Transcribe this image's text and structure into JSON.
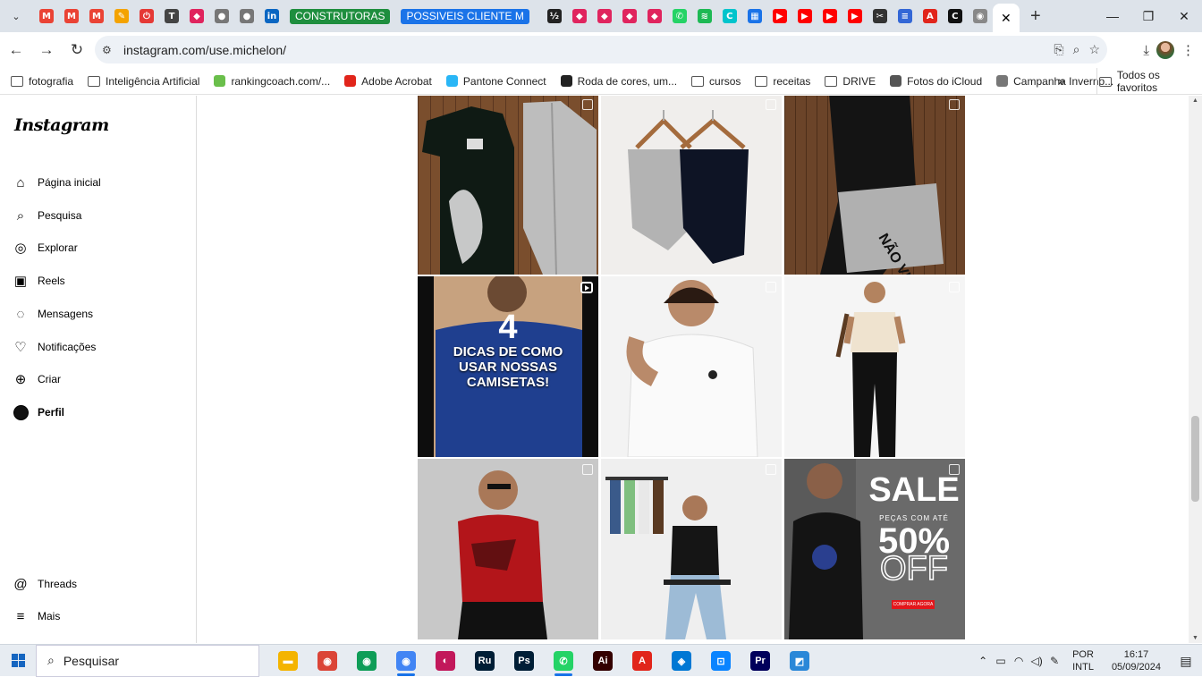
{
  "browser": {
    "url": "instagram.com/use.michelon/",
    "pinned_tabs": [
      {
        "icon": "gmail-icon",
        "color": "#ea4335",
        "glyph": "M"
      },
      {
        "icon": "gmail-icon",
        "color": "#ea4335",
        "glyph": "M"
      },
      {
        "icon": "gmail-icon",
        "color": "#ea4335",
        "glyph": "M"
      },
      {
        "icon": "pencil-app-icon",
        "color": "#f4a300",
        "glyph": "✎"
      },
      {
        "icon": "power-app-icon",
        "color": "#e53935",
        "glyph": "⏻"
      },
      {
        "icon": "t-app-icon",
        "color": "#444444",
        "glyph": "T"
      },
      {
        "icon": "diamond-app-icon",
        "color": "#e0245e",
        "glyph": "◆"
      },
      {
        "icon": "globe-icon",
        "color": "#777777",
        "glyph": "●"
      },
      {
        "icon": "globe-icon",
        "color": "#777777",
        "glyph": "●"
      },
      {
        "icon": "linkedin-icon",
        "color": "#0a66c2",
        "glyph": "in"
      }
    ],
    "label_tabs": [
      {
        "label": "CONSTRUTORAS",
        "color": "#1e8e3e"
      },
      {
        "label": "POSSIVEIS CLIENTE M",
        "color": "#1a73e8"
      }
    ],
    "pinned_tabs_2": [
      {
        "icon": "dark-app-icon",
        "color": "#222222",
        "glyph": "½"
      },
      {
        "icon": "diamond-app-icon",
        "color": "#e0245e",
        "glyph": "◆"
      },
      {
        "icon": "diamond-app-icon",
        "color": "#e0245e",
        "glyph": "◆"
      },
      {
        "icon": "diamond-app-icon",
        "color": "#e0245e",
        "glyph": "◆"
      },
      {
        "icon": "diamond-app-icon",
        "color": "#e0245e",
        "glyph": "◆"
      },
      {
        "icon": "whatsapp-icon",
        "color": "#25d366",
        "glyph": "✆"
      },
      {
        "icon": "spotify-icon",
        "color": "#1db954",
        "glyph": "≋"
      },
      {
        "icon": "canva-icon",
        "color": "#00c4cc",
        "glyph": "C"
      },
      {
        "icon": "calendar-icon",
        "color": "#1a73e8",
        "glyph": "▦"
      },
      {
        "icon": "youtube-icon",
        "color": "#ff0000",
        "glyph": "▶"
      },
      {
        "icon": "youtube-icon",
        "color": "#ff0000",
        "glyph": "▶"
      },
      {
        "icon": "youtube-icon",
        "color": "#ff0000",
        "glyph": "▶"
      },
      {
        "icon": "youtube-icon",
        "color": "#ff0000",
        "glyph": "▶"
      },
      {
        "icon": "capcut-icon",
        "color": "#333333",
        "glyph": "✂"
      },
      {
        "icon": "forms-icon",
        "color": "#3367d6",
        "glyph": "≡"
      },
      {
        "icon": "acrobat-icon",
        "color": "#e1251b",
        "glyph": "A"
      },
      {
        "icon": "circle-app-icon",
        "color": "#111111",
        "glyph": "C"
      },
      {
        "icon": "chrome-icon",
        "color": "#888888",
        "glyph": "◉"
      }
    ],
    "active_tab_close": "✕",
    "new_tab": "+",
    "bookmarks": [
      {
        "label": "fotografia",
        "icon": "folder-icon"
      },
      {
        "label": "Inteligência Artificial",
        "icon": "folder-icon"
      },
      {
        "label": "rankingcoach.com/...",
        "icon": "rankingcoach-icon"
      },
      {
        "label": "Adobe Acrobat",
        "icon": "acrobat-icon"
      },
      {
        "label": "Pantone Connect",
        "icon": "pantone-icon"
      },
      {
        "label": "Roda de cores, um...",
        "icon": "color-wheel-icon"
      },
      {
        "label": "cursos",
        "icon": "folder-icon"
      },
      {
        "label": "receitas",
        "icon": "folder-icon"
      },
      {
        "label": "DRIVE",
        "icon": "folder-icon"
      },
      {
        "label": "Fotos do iCloud",
        "icon": "apple-icon"
      },
      {
        "label": "Campanha Inverno...",
        "icon": "globe-icon"
      }
    ],
    "bookmarks_more": "»",
    "all_bookmarks": "Todos os favoritos"
  },
  "instagram": {
    "logo": "Instagram",
    "nav": [
      {
        "label": "Página inicial",
        "icon": "home-icon",
        "glyph": "⌂"
      },
      {
        "label": "Pesquisa",
        "icon": "search-icon",
        "glyph": "⌕"
      },
      {
        "label": "Explorar",
        "icon": "compass-icon",
        "glyph": "◎"
      },
      {
        "label": "Reels",
        "icon": "reels-icon",
        "glyph": "▣"
      },
      {
        "label": "Mensagens",
        "icon": "messenger-icon",
        "glyph": "◌"
      },
      {
        "label": "Notificações",
        "icon": "heart-icon",
        "glyph": "♡"
      },
      {
        "label": "Criar",
        "icon": "plus-square-icon",
        "glyph": "⊕"
      },
      {
        "label": "Perfil",
        "icon": "profile-avatar",
        "glyph": ""
      }
    ],
    "bottom_nav": [
      {
        "label": "Threads",
        "icon": "threads-icon",
        "glyph": "@"
      },
      {
        "label": "Mais",
        "icon": "menu-icon",
        "glyph": "≡"
      }
    ],
    "posts": [
      {
        "kind": "carousel",
        "alt": "post-tshirt-lion-pants"
      },
      {
        "kind": "carousel",
        "alt": "post-pants-hangers"
      },
      {
        "kind": "carousel",
        "alt": "post-black-pants-gray-tee"
      },
      {
        "kind": "reel",
        "alt": "post-dicas-camisetas",
        "text_num": "4",
        "text": [
          "DICAS DE COMO",
          "USAR NOSSAS",
          "CAMISETAS!"
        ]
      },
      {
        "kind": "carousel",
        "alt": "post-white-tee-man"
      },
      {
        "kind": "carousel",
        "alt": "post-cream-tee-man"
      },
      {
        "kind": "carousel",
        "alt": "post-red-tee-man"
      },
      {
        "kind": "carousel",
        "alt": "post-black-tee-chair"
      },
      {
        "kind": "carousel",
        "alt": "post-sale",
        "sale": "SALE",
        "sale_sub": "PEÇAS COM ATÉ",
        "sale_pct": "50%",
        "sale_off": "OFF",
        "sale_btn": "COMPRAR AGORA"
      }
    ]
  },
  "taskbar": {
    "search_placeholder": "Pesquisar",
    "apps": [
      {
        "icon": "file-explorer-icon",
        "color": "#f4b400",
        "glyph": "▬"
      },
      {
        "icon": "chrome-icon",
        "color": "#db4437",
        "glyph": "◉"
      },
      {
        "icon": "chrome-icon",
        "color": "#0f9d58",
        "glyph": "◉"
      },
      {
        "icon": "chrome-icon",
        "color": "#4285f4",
        "glyph": "◉",
        "active": true
      },
      {
        "icon": "photo-app-icon",
        "color": "#c2185b",
        "glyph": "◐"
      },
      {
        "icon": "lightroom-icon",
        "color": "#001e36",
        "glyph": "Ru"
      },
      {
        "icon": "photoshop-icon",
        "color": "#001e36",
        "glyph": "Ps"
      },
      {
        "icon": "whatsapp-icon",
        "color": "#25d366",
        "glyph": "✆",
        "active": true
      },
      {
        "icon": "illustrator-icon",
        "color": "#330000",
        "glyph": "Ai"
      },
      {
        "icon": "acrobat-icon",
        "color": "#e1251b",
        "glyph": "A"
      },
      {
        "icon": "store-icon",
        "color": "#0078d4",
        "glyph": "◈"
      },
      {
        "icon": "blue-app-icon",
        "color": "#0a84ff",
        "glyph": "⊡"
      },
      {
        "icon": "premiere-icon",
        "color": "#00005b",
        "glyph": "Pr"
      },
      {
        "icon": "paint-app-icon",
        "color": "#2b88d8",
        "glyph": "◩"
      }
    ],
    "lang_1": "POR",
    "lang_2": "INTL",
    "time": "16:17",
    "date": "05/09/2024"
  }
}
